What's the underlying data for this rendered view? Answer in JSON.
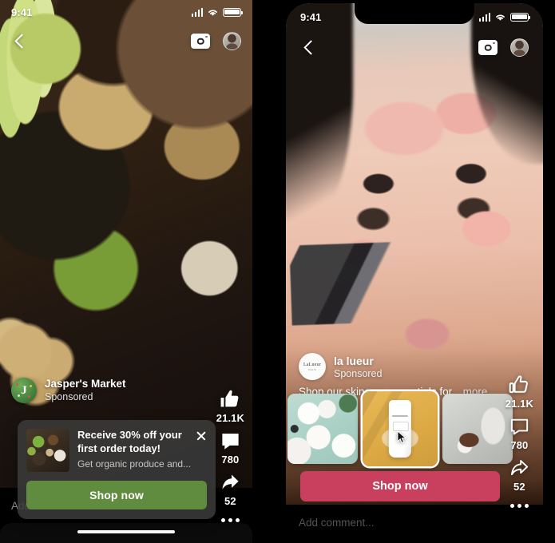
{
  "left_phone": {
    "status_bar": {
      "time": "9:41",
      "signal_icon": "cellular-signal-icon",
      "wifi_icon": "wifi-icon",
      "battery_icon": "battery-icon"
    },
    "nav": {
      "back_icon": "chevron-left-icon",
      "camera_icon": "camera-icon",
      "avatar_icon": "profile-avatar-icon"
    },
    "profile": {
      "avatar_monogram": "J",
      "name": "Jasper's Market",
      "sponsored_label": "Sponsored"
    },
    "promo_card": {
      "thumbnail_alt": "organic produce flat lay",
      "title": "Receive 30% off your first order today!",
      "subtitle": "Get organic produce and...",
      "close_icon": "close-icon",
      "cta_label": "Shop now",
      "cta_color": "#5f8c3e",
      "card_bg": "#3a3a3a"
    },
    "actions": [
      {
        "icon": "thumbs-up-filled-icon",
        "count": "21.1K"
      },
      {
        "icon": "comment-filled-icon",
        "count": "780"
      },
      {
        "icon": "share-filled-icon",
        "count": "52"
      },
      {
        "icon": "more-options-icon",
        "count": ""
      }
    ],
    "comment_bar": {
      "placeholder": "Add Comment..."
    },
    "home_indicator": "home-indicator"
  },
  "right_phone": {
    "status_bar": {
      "time": "9:41",
      "signal_icon": "cellular-signal-icon",
      "wifi_icon": "wifi-icon",
      "battery_icon": "battery-icon"
    },
    "nav": {
      "back_icon": "chevron-left-icon",
      "camera_icon": "camera-icon",
      "avatar_icon": "profile-avatar-icon"
    },
    "profile": {
      "avatar_wordmark": "LaLueur",
      "avatar_subtext": "PARIS",
      "name": "la lueur",
      "sponsored_label": "Sponsored"
    },
    "caption": {
      "text": "Shop our skincare essentials for...",
      "more_label": "more"
    },
    "carousel": [
      {
        "label": "skincare flat lay",
        "selected": false
      },
      {
        "label": "cleanser tube on yellow",
        "selected": true
      },
      {
        "label": "lotion on hand",
        "selected": false
      }
    ],
    "cta": {
      "label": "Shop now",
      "color": "#c9405f"
    },
    "actions": [
      {
        "icon": "thumbs-up-outline-icon",
        "count": "21.1K"
      },
      {
        "icon": "comment-outline-icon",
        "count": "780"
      },
      {
        "icon": "share-outline-icon",
        "count": "52"
      },
      {
        "icon": "more-options-icon",
        "count": ""
      }
    ],
    "comment_bar": {
      "placeholder": "Add comment..."
    },
    "cursor_icon": "mouse-cursor-icon"
  }
}
